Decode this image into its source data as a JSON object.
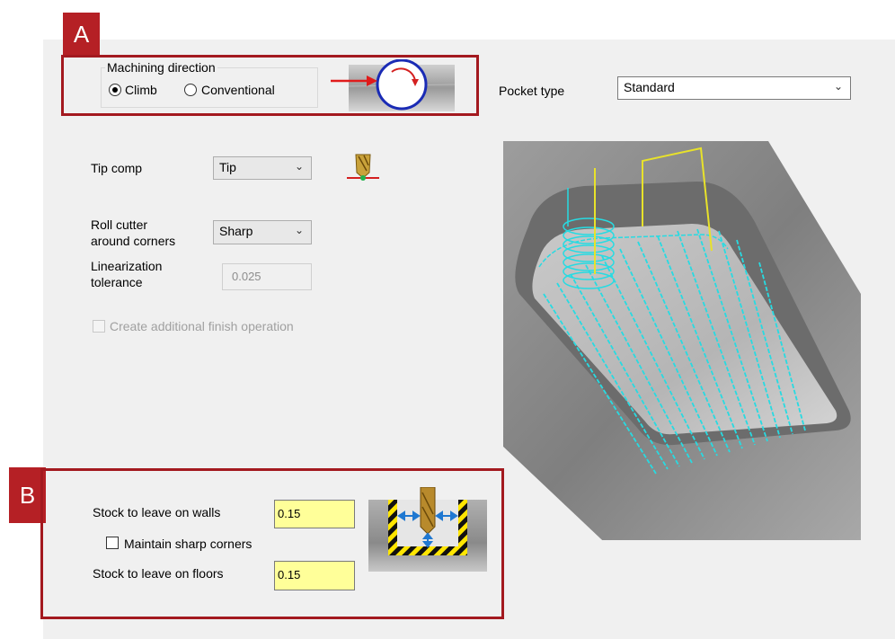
{
  "callouts": {
    "a": "A",
    "b": "B"
  },
  "machining_direction": {
    "title": "Machining direction",
    "options": [
      {
        "label": "Climb",
        "selected": true
      },
      {
        "label": "Conventional",
        "selected": false
      }
    ]
  },
  "pocket_type": {
    "label": "Pocket type",
    "value": "Standard"
  },
  "tip_comp": {
    "label": "Tip comp",
    "value": "Tip"
  },
  "roll_cutter": {
    "label_line1": "Roll cutter",
    "label_line2": "around corners",
    "value": "Sharp"
  },
  "linearization": {
    "label_line1": "Linearization",
    "label_line2": "tolerance",
    "value": "0.025",
    "enabled": false
  },
  "finish_op": {
    "label": "Create additional finish operation",
    "checked": false,
    "enabled": false
  },
  "stock_walls": {
    "label": "Stock to leave on walls",
    "value": "0.15"
  },
  "sharp_corners": {
    "label": "Maintain sharp corners",
    "checked": false
  },
  "stock_floors": {
    "label": "Stock to leave on floors",
    "value": "0.15"
  },
  "colors": {
    "callout_red": "#b52025",
    "toolpath": "#27dbe2",
    "rapid": "#e8e22a",
    "field_highlight": "#ffff99"
  },
  "icons": [
    "climb-direction-diagram",
    "tip-comp-tool-icon",
    "pocket-toolpath-preview",
    "stock-to-leave-diagram",
    "chevron-down-icon"
  ]
}
